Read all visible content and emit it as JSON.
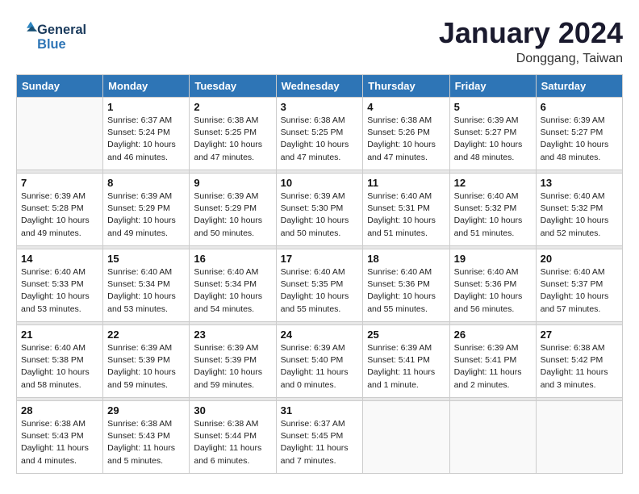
{
  "header": {
    "logo_line1": "General",
    "logo_line2": "Blue",
    "month_title": "January 2024",
    "location": "Donggang, Taiwan"
  },
  "days_of_week": [
    "Sunday",
    "Monday",
    "Tuesday",
    "Wednesday",
    "Thursday",
    "Friday",
    "Saturday"
  ],
  "weeks": [
    [
      {
        "day": "",
        "sunrise": "",
        "sunset": "",
        "daylight": ""
      },
      {
        "day": "1",
        "sunrise": "Sunrise: 6:37 AM",
        "sunset": "Sunset: 5:24 PM",
        "daylight": "Daylight: 10 hours and 46 minutes."
      },
      {
        "day": "2",
        "sunrise": "Sunrise: 6:38 AM",
        "sunset": "Sunset: 5:25 PM",
        "daylight": "Daylight: 10 hours and 47 minutes."
      },
      {
        "day": "3",
        "sunrise": "Sunrise: 6:38 AM",
        "sunset": "Sunset: 5:25 PM",
        "daylight": "Daylight: 10 hours and 47 minutes."
      },
      {
        "day": "4",
        "sunrise": "Sunrise: 6:38 AM",
        "sunset": "Sunset: 5:26 PM",
        "daylight": "Daylight: 10 hours and 47 minutes."
      },
      {
        "day": "5",
        "sunrise": "Sunrise: 6:39 AM",
        "sunset": "Sunset: 5:27 PM",
        "daylight": "Daylight: 10 hours and 48 minutes."
      },
      {
        "day": "6",
        "sunrise": "Sunrise: 6:39 AM",
        "sunset": "Sunset: 5:27 PM",
        "daylight": "Daylight: 10 hours and 48 minutes."
      }
    ],
    [
      {
        "day": "7",
        "sunrise": "Sunrise: 6:39 AM",
        "sunset": "Sunset: 5:28 PM",
        "daylight": "Daylight: 10 hours and 49 minutes."
      },
      {
        "day": "8",
        "sunrise": "Sunrise: 6:39 AM",
        "sunset": "Sunset: 5:29 PM",
        "daylight": "Daylight: 10 hours and 49 minutes."
      },
      {
        "day": "9",
        "sunrise": "Sunrise: 6:39 AM",
        "sunset": "Sunset: 5:29 PM",
        "daylight": "Daylight: 10 hours and 50 minutes."
      },
      {
        "day": "10",
        "sunrise": "Sunrise: 6:39 AM",
        "sunset": "Sunset: 5:30 PM",
        "daylight": "Daylight: 10 hours and 50 minutes."
      },
      {
        "day": "11",
        "sunrise": "Sunrise: 6:40 AM",
        "sunset": "Sunset: 5:31 PM",
        "daylight": "Daylight: 10 hours and 51 minutes."
      },
      {
        "day": "12",
        "sunrise": "Sunrise: 6:40 AM",
        "sunset": "Sunset: 5:32 PM",
        "daylight": "Daylight: 10 hours and 51 minutes."
      },
      {
        "day": "13",
        "sunrise": "Sunrise: 6:40 AM",
        "sunset": "Sunset: 5:32 PM",
        "daylight": "Daylight: 10 hours and 52 minutes."
      }
    ],
    [
      {
        "day": "14",
        "sunrise": "Sunrise: 6:40 AM",
        "sunset": "Sunset: 5:33 PM",
        "daylight": "Daylight: 10 hours and 53 minutes."
      },
      {
        "day": "15",
        "sunrise": "Sunrise: 6:40 AM",
        "sunset": "Sunset: 5:34 PM",
        "daylight": "Daylight: 10 hours and 53 minutes."
      },
      {
        "day": "16",
        "sunrise": "Sunrise: 6:40 AM",
        "sunset": "Sunset: 5:34 PM",
        "daylight": "Daylight: 10 hours and 54 minutes."
      },
      {
        "day": "17",
        "sunrise": "Sunrise: 6:40 AM",
        "sunset": "Sunset: 5:35 PM",
        "daylight": "Daylight: 10 hours and 55 minutes."
      },
      {
        "day": "18",
        "sunrise": "Sunrise: 6:40 AM",
        "sunset": "Sunset: 5:36 PM",
        "daylight": "Daylight: 10 hours and 55 minutes."
      },
      {
        "day": "19",
        "sunrise": "Sunrise: 6:40 AM",
        "sunset": "Sunset: 5:36 PM",
        "daylight": "Daylight: 10 hours and 56 minutes."
      },
      {
        "day": "20",
        "sunrise": "Sunrise: 6:40 AM",
        "sunset": "Sunset: 5:37 PM",
        "daylight": "Daylight: 10 hours and 57 minutes."
      }
    ],
    [
      {
        "day": "21",
        "sunrise": "Sunrise: 6:40 AM",
        "sunset": "Sunset: 5:38 PM",
        "daylight": "Daylight: 10 hours and 58 minutes."
      },
      {
        "day": "22",
        "sunrise": "Sunrise: 6:39 AM",
        "sunset": "Sunset: 5:39 PM",
        "daylight": "Daylight: 10 hours and 59 minutes."
      },
      {
        "day": "23",
        "sunrise": "Sunrise: 6:39 AM",
        "sunset": "Sunset: 5:39 PM",
        "daylight": "Daylight: 10 hours and 59 minutes."
      },
      {
        "day": "24",
        "sunrise": "Sunrise: 6:39 AM",
        "sunset": "Sunset: 5:40 PM",
        "daylight": "Daylight: 11 hours and 0 minutes."
      },
      {
        "day": "25",
        "sunrise": "Sunrise: 6:39 AM",
        "sunset": "Sunset: 5:41 PM",
        "daylight": "Daylight: 11 hours and 1 minute."
      },
      {
        "day": "26",
        "sunrise": "Sunrise: 6:39 AM",
        "sunset": "Sunset: 5:41 PM",
        "daylight": "Daylight: 11 hours and 2 minutes."
      },
      {
        "day": "27",
        "sunrise": "Sunrise: 6:38 AM",
        "sunset": "Sunset: 5:42 PM",
        "daylight": "Daylight: 11 hours and 3 minutes."
      }
    ],
    [
      {
        "day": "28",
        "sunrise": "Sunrise: 6:38 AM",
        "sunset": "Sunset: 5:43 PM",
        "daylight": "Daylight: 11 hours and 4 minutes."
      },
      {
        "day": "29",
        "sunrise": "Sunrise: 6:38 AM",
        "sunset": "Sunset: 5:43 PM",
        "daylight": "Daylight: 11 hours and 5 minutes."
      },
      {
        "day": "30",
        "sunrise": "Sunrise: 6:38 AM",
        "sunset": "Sunset: 5:44 PM",
        "daylight": "Daylight: 11 hours and 6 minutes."
      },
      {
        "day": "31",
        "sunrise": "Sunrise: 6:37 AM",
        "sunset": "Sunset: 5:45 PM",
        "daylight": "Daylight: 11 hours and 7 minutes."
      },
      {
        "day": "",
        "sunrise": "",
        "sunset": "",
        "daylight": ""
      },
      {
        "day": "",
        "sunrise": "",
        "sunset": "",
        "daylight": ""
      },
      {
        "day": "",
        "sunrise": "",
        "sunset": "",
        "daylight": ""
      }
    ]
  ]
}
